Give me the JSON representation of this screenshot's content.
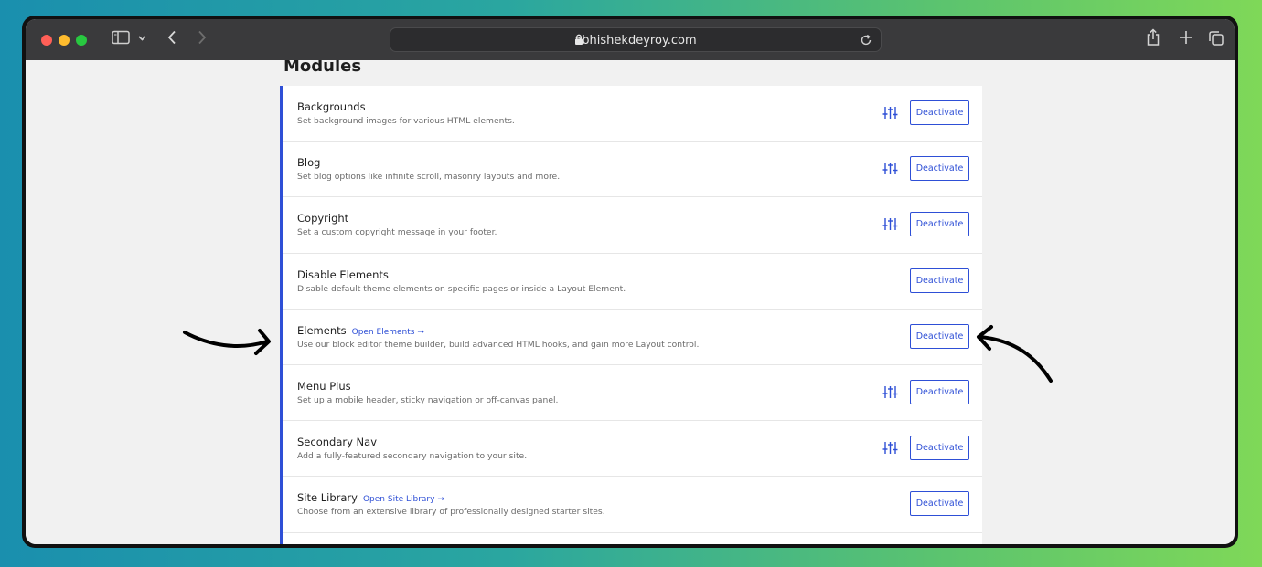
{
  "browser": {
    "url": "abhishekdeyroy.com",
    "icons": [
      "sidebar-icon",
      "chevron-down-icon",
      "back-icon",
      "forward-icon",
      "lock-icon",
      "reload-icon",
      "share-icon",
      "new-tab-icon",
      "tabs-overview-icon"
    ]
  },
  "page": {
    "heading": "Modules",
    "accent_color": "#2e4fd6"
  },
  "modules": [
    {
      "title": "Backgrounds",
      "desc": "Set background images for various HTML elements.",
      "link": "",
      "has_settings": true,
      "button": "Deactivate"
    },
    {
      "title": "Blog",
      "desc": "Set blog options like infinite scroll, masonry layouts and more.",
      "link": "",
      "has_settings": true,
      "button": "Deactivate"
    },
    {
      "title": "Copyright",
      "desc": "Set a custom copyright message in your footer.",
      "link": "",
      "has_settings": true,
      "button": "Deactivate"
    },
    {
      "title": "Disable Elements",
      "desc": "Disable default theme elements on specific pages or inside a Layout Element.",
      "link": "",
      "has_settings": false,
      "button": "Deactivate"
    },
    {
      "title": "Elements",
      "desc": "Use our block editor theme builder, build advanced HTML hooks, and gain more Layout control.",
      "link": "Open Elements →",
      "has_settings": false,
      "button": "Deactivate"
    },
    {
      "title": "Menu Plus",
      "desc": "Set up a mobile header, sticky navigation or off-canvas panel.",
      "link": "",
      "has_settings": true,
      "button": "Deactivate"
    },
    {
      "title": "Secondary Nav",
      "desc": "Add a fully-featured secondary navigation to your site.",
      "link": "",
      "has_settings": true,
      "button": "Deactivate"
    },
    {
      "title": "Site Library",
      "desc": "Choose from an extensive library of professionally designed starter sites.",
      "link": "Open Site Library →",
      "has_settings": false,
      "button": "Deactivate"
    }
  ]
}
